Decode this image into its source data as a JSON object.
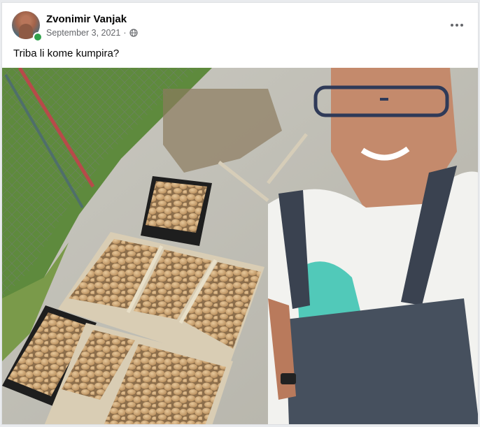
{
  "post": {
    "author_name": "Zvonimir Vanjak",
    "date": "September 3, 2021",
    "separator": "·",
    "privacy_icon": "globe-icon",
    "menu_icon": "more-options-icon",
    "text": "Triba li kome kumpira?",
    "photo_icon": "photo-selfie-potatoes"
  }
}
